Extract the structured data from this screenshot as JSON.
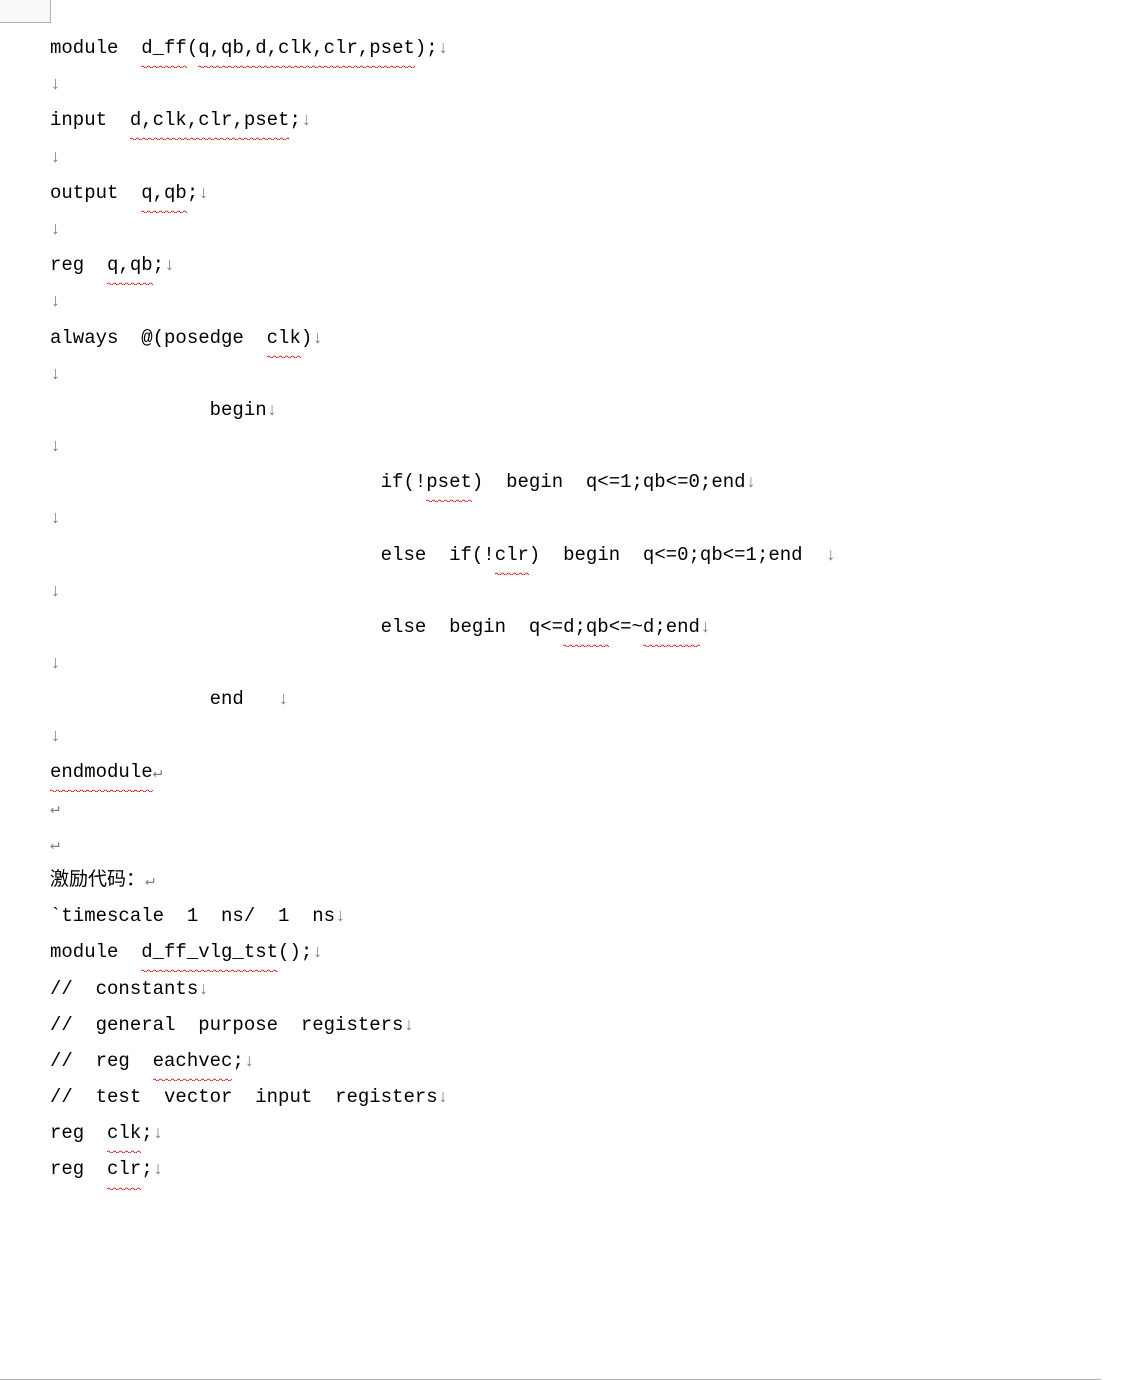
{
  "code": {
    "l1_a": "module  ",
    "l1_b": "d_ff",
    "l1_c": "(",
    "l1_d": "q,qb,d,clk,clr,pset",
    "l1_e": ");",
    "l3_a": "input  ",
    "l3_b": "d,clk,clr,pset",
    "l3_c": ";",
    "l5_a": "output  ",
    "l5_b": "q,qb",
    "l5_c": ";",
    "l7_a": "reg  ",
    "l7_b": "q,qb",
    "l7_c": ";",
    "l9_a": "always  @(posedge  ",
    "l9_b": "clk",
    "l9_c": ")",
    "l11": "              begin",
    "l13_a": "                             if(!",
    "l13_b": "pset",
    "l13_c": ")  begin  q<=1;qb<=0;end",
    "l15_a": "                             else  if(!",
    "l15_b": "clr",
    "l15_c": ")  begin  q<=0;qb<=1;end  ",
    "l17_a": "                             else  begin  q<=",
    "l17_b": "d;qb",
    "l17_c": "<=~",
    "l17_d": "d;end",
    "l19": "              end   ",
    "l21": "endmodule",
    "l24": "激励代码：",
    "l25": "`timescale  1  ns/  1  ns",
    "l26_a": "module  ",
    "l26_b": "d_ff_vlg_tst",
    "l26_c": "();",
    "l27": "//  constants",
    "l28": "//  general  purpose  registers",
    "l29_a": "//  reg  ",
    "l29_b": "eachvec",
    "l29_c": ";",
    "l30": "//  test  vector  input  registers",
    "l31_a": "reg  ",
    "l31_b": "clk",
    "l31_c": ";",
    "l32_a": "reg  ",
    "l32_b": "clr",
    "l32_c": ";"
  },
  "glyphs": {
    "down": "↓",
    "ret": "↵"
  }
}
